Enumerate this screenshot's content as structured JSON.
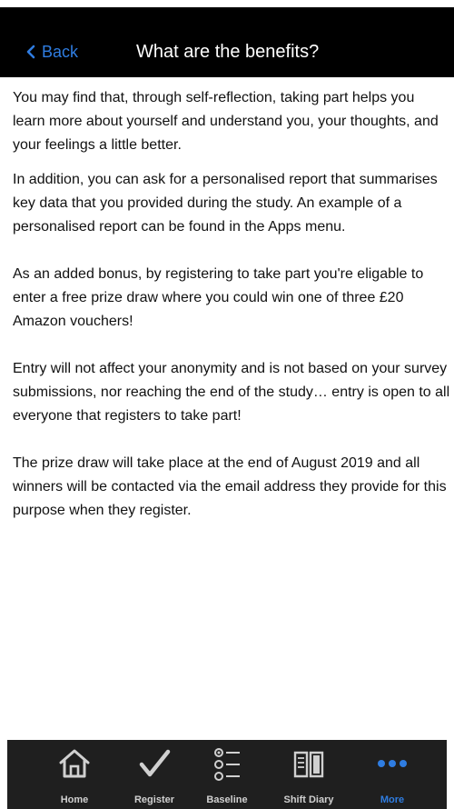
{
  "header": {
    "back_label": "Back",
    "title": "What are the benefits?"
  },
  "content": {
    "paragraphs": [
      "You may find that, through self-reflection, taking part helps you learn more about yourself and understand you, your thoughts, and your feelings a little better.",
      "In addition, you can ask for a personalised report that summarises key data that you provided during the study. An example of a personalised report can be found in the Apps menu.",
      "As an added bonus, by registering to take part you're eligable to enter a free prize draw where you could win one of three £20 Amazon vouchers!",
      "Entry will not affect your anonymity and is not based on your survey submissions, nor reaching the end of the study… entry is open to all everyone that registers to take part!",
      "The prize draw will take place at the end of August 2019 and all winners will be contacted via the email address they provide for this purpose when they register."
    ]
  },
  "tabbar": {
    "tabs": [
      {
        "label": "Home",
        "icon": "home-icon"
      },
      {
        "label": "Register",
        "icon": "checkmark-icon"
      },
      {
        "label": "Baseline",
        "icon": "list-icon"
      },
      {
        "label": "Shift Diary",
        "icon": "book-icon"
      },
      {
        "label": "More",
        "icon": "more-dots-icon",
        "active": true
      }
    ]
  },
  "colors": {
    "accent": "#2f7de1",
    "navbar_bg": "#000000",
    "tabbar_bg": "#1f1f1f",
    "tab_inactive": "#d0d0d0"
  }
}
